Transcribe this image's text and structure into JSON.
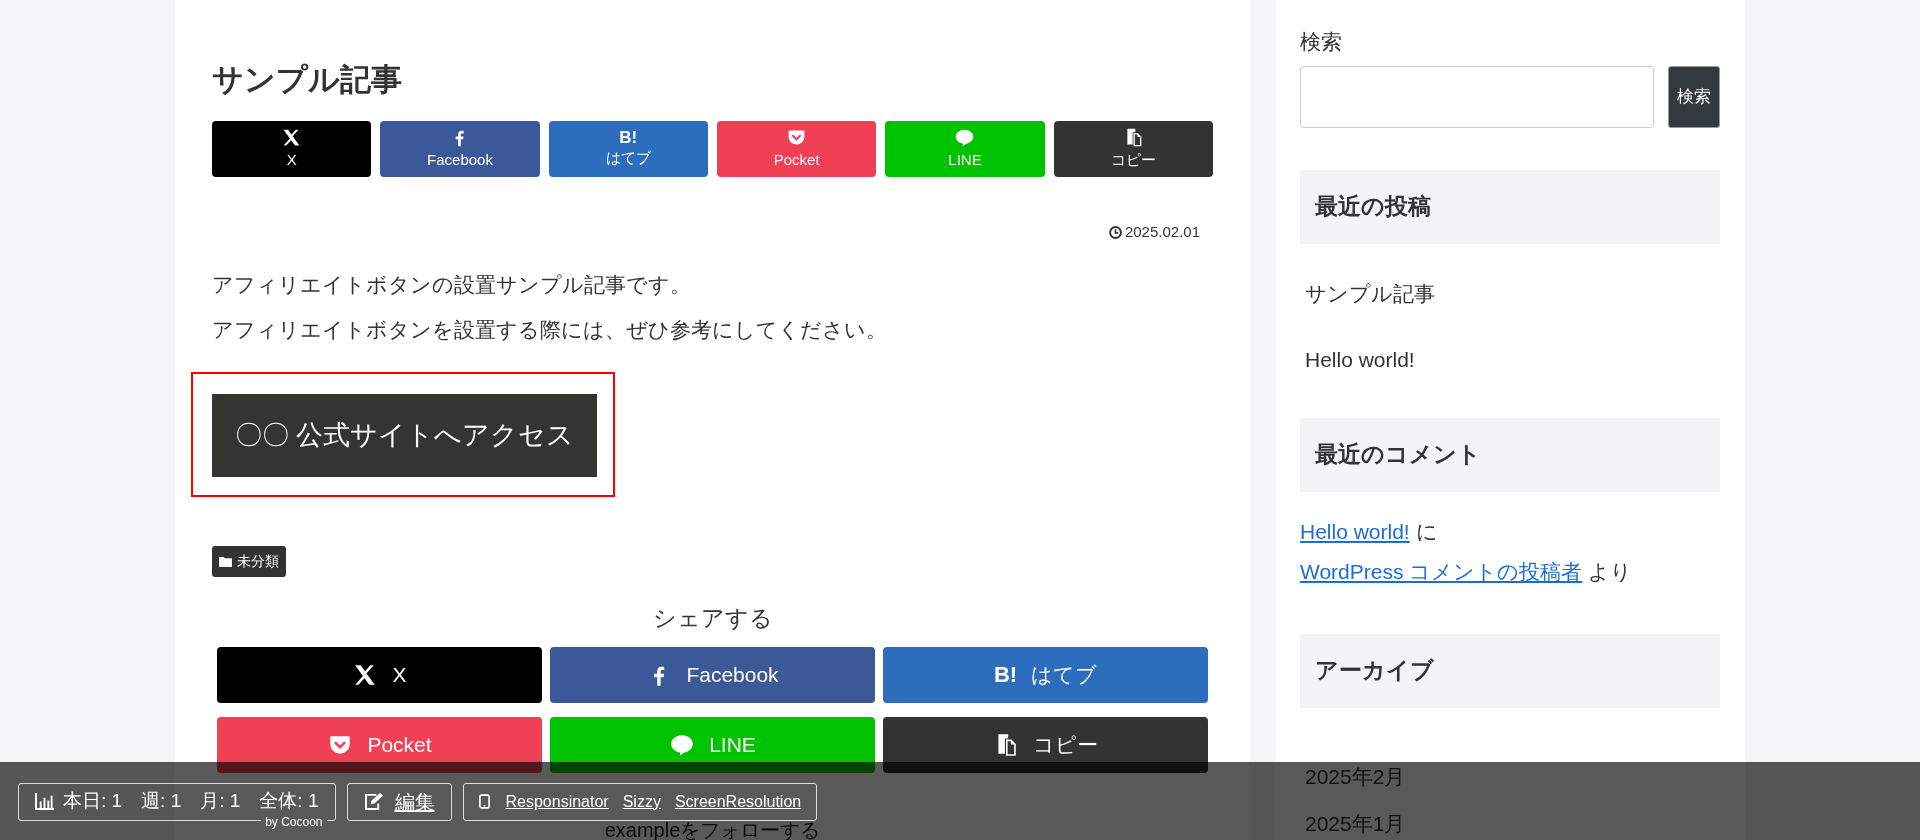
{
  "article": {
    "title": "サンプル記事",
    "share_top": [
      {
        "kind": "x",
        "label": "X",
        "color": "#000000"
      },
      {
        "kind": "facebook",
        "label": "Facebook",
        "color": "#3b5998"
      },
      {
        "kind": "hatena",
        "label": "はてブ",
        "icon_text": "B!",
        "color": "#2c6ebd"
      },
      {
        "kind": "pocket",
        "label": "Pocket",
        "color": "#ef4056"
      },
      {
        "kind": "line",
        "label": "LINE",
        "color": "#00c300"
      },
      {
        "kind": "copy",
        "label": "コピー",
        "color": "#333333"
      }
    ],
    "date": "2025.02.01",
    "paragraphs": [
      "アフィリエイトボタンの設置サンプル記事です。",
      "アフィリエイトボタンを設置する際には、ぜひ参考にしてください。"
    ],
    "affiliate_button": "〇〇 公式サイトへアクセス",
    "category": "未分類",
    "share_heading": "シェアする",
    "share_bottom": [
      {
        "kind": "x",
        "label": "X",
        "color": "#000000"
      },
      {
        "kind": "facebook",
        "label": "Facebook",
        "color": "#3b5998"
      },
      {
        "kind": "hatena",
        "label": "はてブ",
        "icon_text": "B!",
        "color": "#2c6ebd"
      },
      {
        "kind": "pocket",
        "label": "Pocket",
        "color": "#ef4056"
      },
      {
        "kind": "line",
        "label": "LINE",
        "color": "#00c300"
      },
      {
        "kind": "copy",
        "label": "コピー",
        "color": "#333333"
      }
    ],
    "follow_heading": "exampleをフォローする"
  },
  "sidebar": {
    "search": {
      "label": "検索",
      "button": "検索"
    },
    "recent_posts": {
      "title": "最近の投稿",
      "items": [
        "サンプル記事",
        "Hello world!"
      ]
    },
    "recent_comments": {
      "title": "最近のコメント",
      "items": [
        {
          "post": "Hello world!",
          "on": "に",
          "author": "WordPress コメントの投稿者",
          "by": "より"
        }
      ]
    },
    "archives": {
      "title": "アーカイブ",
      "items": [
        "2025年2月",
        "2025年1月"
      ]
    }
  },
  "admin_bar": {
    "stats": "本日: 1　週: 1　月: 1　全体: 1",
    "stats_credit": "by Cocoon",
    "edit": "編集",
    "links": [
      "Responsinator",
      "Sizzy",
      "ScreenResolution"
    ]
  }
}
